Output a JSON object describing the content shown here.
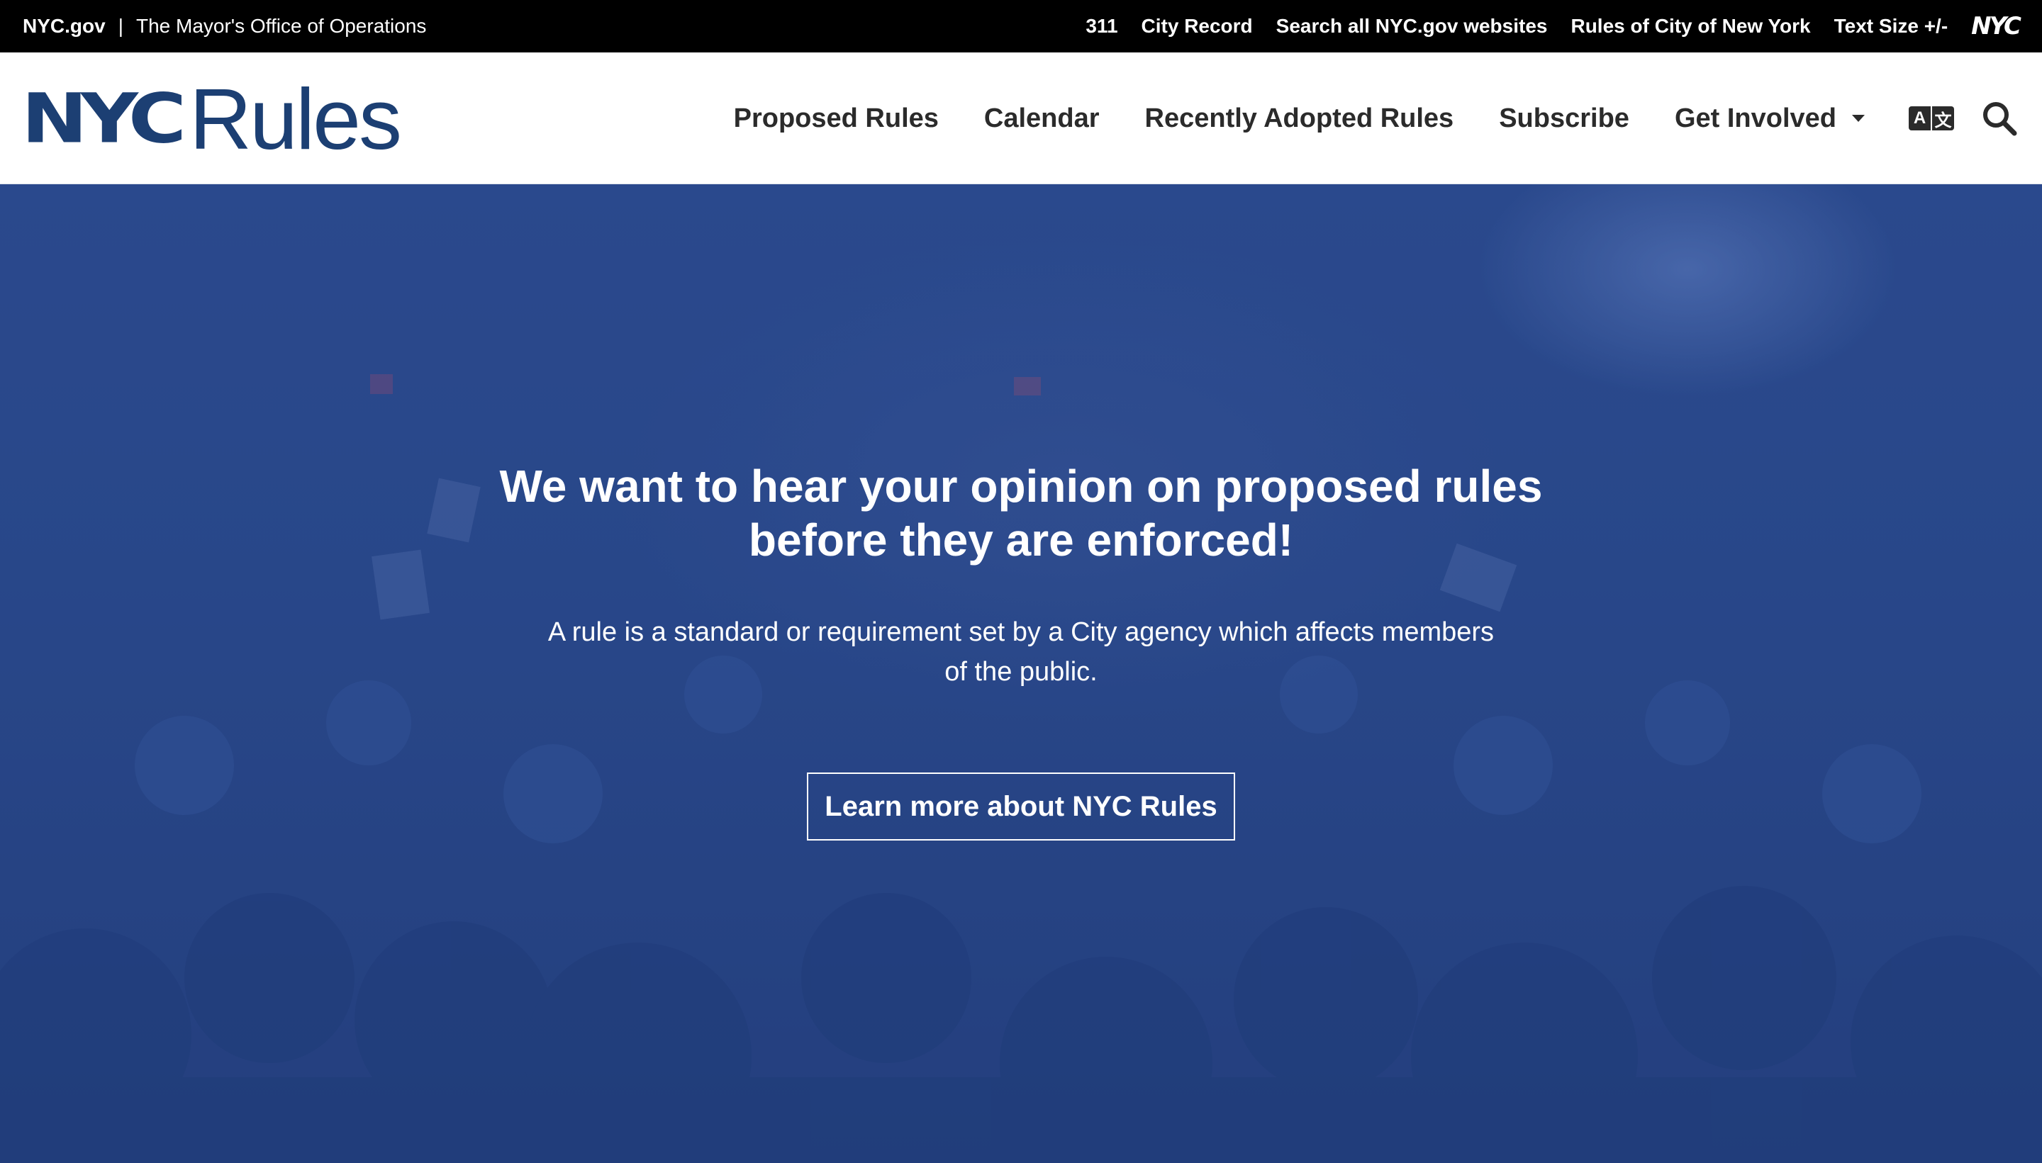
{
  "topbar": {
    "site": "NYC.gov",
    "separator": "|",
    "office": "The Mayor's Office of Operations",
    "links": [
      "311",
      "City Record",
      "Search all NYC.gov websites",
      "Rules of City of New York",
      "Text Size +/-"
    ],
    "nyc_logo": "NYC"
  },
  "header": {
    "logo_nyc": "NYC",
    "logo_rules": "Rules",
    "nav": [
      "Proposed Rules",
      "Calendar",
      "Recently Adopted Rules",
      "Subscribe",
      "Get Involved"
    ],
    "icons": [
      "translate-icon",
      "search-icon"
    ],
    "translate_a": "A",
    "translate_b": "文"
  },
  "hero": {
    "title": "We want to hear your opinion on proposed rules before they are enforced!",
    "subtitle": "A rule is a standard or requirement set by a City agency which affects members of the public.",
    "button": "Learn more about NYC Rules"
  },
  "colors": {
    "brand_blue": "#1c3f73",
    "hero_overlay": "#2c4a8a",
    "topbar_bg": "#000000"
  }
}
